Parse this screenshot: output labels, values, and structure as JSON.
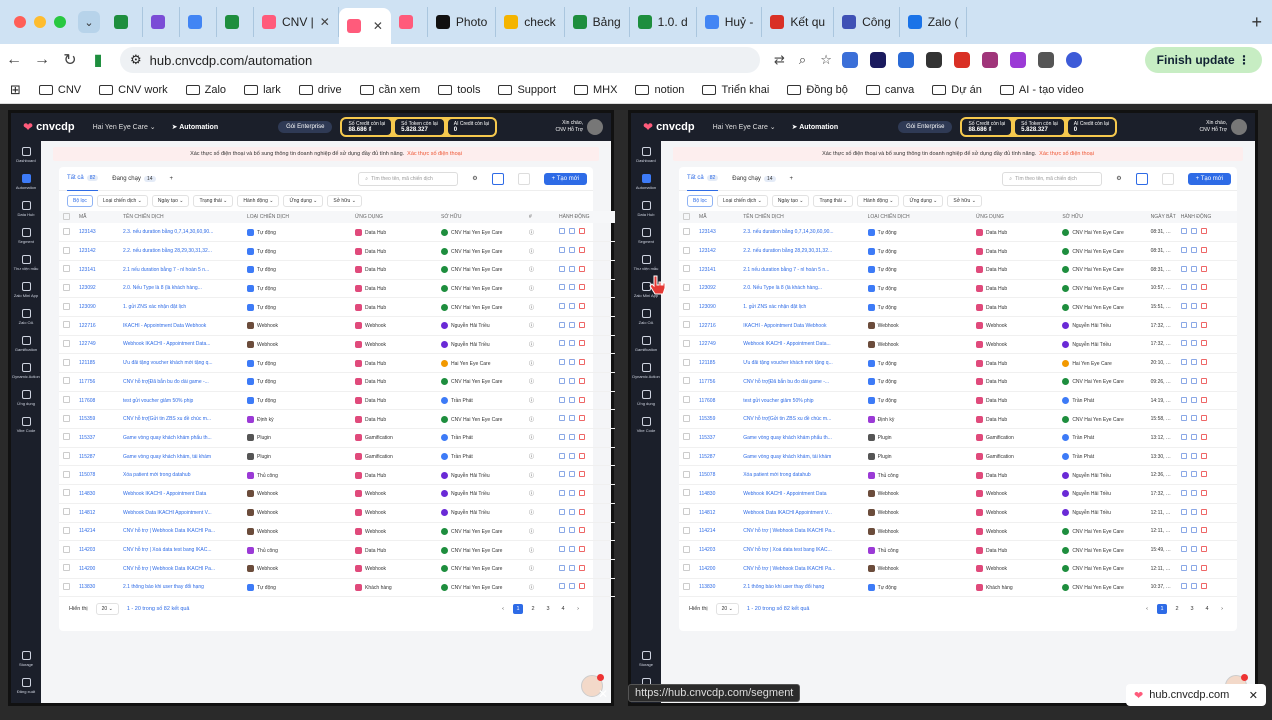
{
  "browser": {
    "tabs": [
      {
        "label": "",
        "color": "#1e8e3e"
      },
      {
        "label": "",
        "color": "#7b4dd6"
      },
      {
        "label": "",
        "color": "#4285f4"
      },
      {
        "label": "",
        "color": "#1e8e3e"
      },
      {
        "label": "CNV |",
        "color": "#ff5b7b"
      },
      {
        "label": "",
        "color": "#ff5b7b",
        "active": true
      },
      {
        "label": "",
        "color": "#ff5b7b"
      },
      {
        "label": "Photo",
        "color": "#111111"
      },
      {
        "label": "check",
        "color": "#f4b400"
      },
      {
        "label": "Bảng",
        "color": "#1e8e3e"
      },
      {
        "label": "1.0. d",
        "color": "#1e8e3e"
      },
      {
        "label": "Huỷ -",
        "color": "#4285f4"
      },
      {
        "label": "Kết qu",
        "color": "#d93025"
      },
      {
        "label": "Công",
        "color": "#3f51b5"
      },
      {
        "label": "Zalo (",
        "color": "#1a73e8"
      }
    ],
    "url": "hub.cnvcdp.com/automation",
    "finish_update": "Finish update",
    "bookmarks": [
      "CNV",
      "CNV work",
      "Zalo",
      "lark",
      "drive",
      "cần xem",
      "tools",
      "Support",
      "MHX",
      "notion",
      "Triển khai",
      "Đồng bộ",
      "canva",
      "Dự án",
      "AI - tạo video"
    ],
    "status_url": "https://hub.cnvcdp.com/segment",
    "popup_label": "hub.cnvcdp.com"
  },
  "app": {
    "logo": "cnvcdp",
    "org": "Hai Yen Eye Care",
    "module": "Automation",
    "plan": "Gói Enterprise",
    "credits": [
      {
        "label": "Số Credit còn lại",
        "value": "88.686 ₫"
      },
      {
        "label": "Số Token còn lại",
        "value": "5.828.327"
      },
      {
        "label": "AI Credit còn lại",
        "value": "0"
      }
    ],
    "hello": "Xin chào,",
    "user": "CNV Hỗ Trợ",
    "sidebar": [
      "Dashboard",
      "Automation",
      "Data Hub",
      "Segment",
      "Thư viện mẫu",
      "Zalo Mini App",
      "Zalo OA",
      "Gamification",
      "Dynamic Action",
      "Ứng dụng",
      "Vibe Code"
    ],
    "sidebar_bottom": [
      "Storage",
      "Đăng xuất"
    ],
    "alert": "Xác thực số điện thoại và bổ sung thông tin doanh nghiệp để sử dụng đầy đủ tính năng.",
    "alert_link": "Xác thực số điện thoại",
    "tab_all": "Tất cả",
    "tab_all_count": "82",
    "tab_running": "Đang chạy",
    "tab_running_count": "14",
    "search_placeholder": "Tìm theo tên, mã chiến dịch",
    "add_button": "+ Tạo mới",
    "filters": [
      "Bộ lọc",
      "Loại chiến dịch",
      "Ngày tạo",
      "Trạng thái",
      "Hành động",
      "Ứng dụng",
      "Sở hữu"
    ],
    "columns_left": [
      "MÃ",
      "TÊN CHIẾN DỊCH",
      "LOẠI CHIẾN DỊCH",
      "ỨNG DỤNG",
      "SỞ HỮU",
      "#",
      "HÀNH ĐỘNG"
    ],
    "columns_right": [
      "MÃ",
      "TÊN CHIẾN DỊCH",
      "LOẠI CHIẾN DỊCH",
      "ỨNG DỤNG",
      "SỞ HỮU",
      "NGÀY BẮT ĐẦU",
      "HÀNH ĐỘNG"
    ],
    "rows": [
      {
        "id": "123143",
        "name": "2.3. nếu duration bằng 0,7,14,30,60,90...",
        "type": "Tự động",
        "app": "Data Hub",
        "owner": "CNV Hai Yen Eye Care",
        "date": "08:31, 13/06/"
      },
      {
        "id": "123142",
        "name": "2.2. nếu duration bằng 28,29,30,31,32...",
        "type": "Tự động",
        "app": "Data Hub",
        "owner": "CNV Hai Yen Eye Care",
        "date": "08:31, 13/06/"
      },
      {
        "id": "123141",
        "name": "2.1 nếu duration bằng 7 - nl hoàn 5 n...",
        "type": "Tự động",
        "app": "Data Hub",
        "owner": "CNV Hai Yen Eye Care",
        "date": "08:31, 13/06/"
      },
      {
        "id": "123092",
        "name": "2.0. Nếu Type là 8 (là khách hàng...",
        "type": "Tự động",
        "app": "Data Hub",
        "owner": "CNV Hai Yen Eye Care",
        "date": "10:57, 12/06/"
      },
      {
        "id": "123090",
        "name": "1. gửi ZNS xác nhận đặt lịch",
        "type": "Tự động",
        "app": "Data Hub",
        "owner": "CNV Hai Yen Eye Care",
        "date": "15:51, 11/06/"
      },
      {
        "id": "122716",
        "name": "IKACHI - Appointment Data Webhook",
        "type": "Webhook",
        "app": "Webhook",
        "owner": "Nguyễn Hải Triều",
        "date": "17:32, 07/06/"
      },
      {
        "id": "122749",
        "name": "Webhook IKACHI - Appointment Data...",
        "type": "Webhook",
        "app": "Webhook",
        "owner": "Nguyễn Hải Triều",
        "date": "17:32, 07/06/"
      },
      {
        "id": "121185",
        "name": "Ưu đãi tặng voucher khách mới tặng q...",
        "type": "Tự động",
        "app": "Data Hub",
        "owner": "Hai Yen Eye Care",
        "date": "20:10, 31/05/"
      },
      {
        "id": "117756",
        "name": "CNV hỗ trợ[Đã bắn bu đo dài game -...",
        "type": "Tự động",
        "app": "Data Hub",
        "owner": "CNV Hai Yen Eye Care",
        "date": "09:26, 04/05/"
      },
      {
        "id": "117608",
        "name": "test gửi voucher giảm 50% phịp",
        "type": "Tự động",
        "app": "Data Hub",
        "owner": "Trần Phát",
        "date": "14:19, 29/04/"
      },
      {
        "id": "115359",
        "name": "CNV hỗ trợ[Gửi tin ZBS xu đề chúc m...",
        "type": "Định kỳ",
        "app": "Data Hub",
        "owner": "CNV Hai Yen Eye Care",
        "date": "15:58, 16/04/"
      },
      {
        "id": "115337",
        "name": "Game vòng quay khách khám phẩu th...",
        "type": "Plugin",
        "app": "Gamification",
        "owner": "Trần Phát",
        "date": "13:12, 10/04/"
      },
      {
        "id": "115287",
        "name": "Game vòng quay khách khám, tái khám",
        "type": "Plugin",
        "app": "Gamification",
        "owner": "Trần Phát",
        "date": "13:30, 10/04/"
      },
      {
        "id": "115078",
        "name": "Xóa patient mới trong datahub",
        "type": "Thủ công",
        "app": "Data Hub",
        "owner": "Nguyễn Hải Triều",
        "date": "12:36, 08/04/"
      },
      {
        "id": "114830",
        "name": "Webhook IKACHI - Appointment Data",
        "type": "Webhook",
        "app": "Webhook",
        "owner": "Nguyễn Hải Triều",
        "date": "17:32, 07/04/"
      },
      {
        "id": "114812",
        "name": "Webhook Data IKACHI Appointment V...",
        "type": "Webhook",
        "app": "Webhook",
        "owner": "Nguyễn Hải Triều",
        "date": "12:11, 28/03/"
      },
      {
        "id": "114214",
        "name": "CNV hỗ trợ | Webhook Data IKACHI Pa...",
        "type": "Webhook",
        "app": "Webhook",
        "owner": "CNV Hai Yen Eye Care",
        "date": "12:11, 26/03/"
      },
      {
        "id": "114203",
        "name": "CNV hỗ trợ | Xoá data test bang IKAC...",
        "type": "Thủ công",
        "app": "Data Hub",
        "owner": "CNV Hai Yen Eye Care",
        "date": "15:49, 03/03/"
      },
      {
        "id": "114200",
        "name": "CNV hỗ trợ | Webhook Data IKACHI Pa...",
        "type": "Webhook",
        "app": "Webhook",
        "owner": "CNV Hai Yen Eye Care",
        "date": "12:11, 26/03/"
      },
      {
        "id": "113830",
        "name": "2.1 thông báo khi user thay đổi hạng",
        "type": "Tự động",
        "app": "Khách hàng",
        "owner": "CNV Hai Yen Eye Care",
        "date": "10:37, 01/04/"
      }
    ],
    "per_page_label": "Hiển thị",
    "per_page": "20",
    "result_text": "1 - 20 trong số 82 kết quả",
    "pages": [
      "1",
      "2",
      "3",
      "4"
    ]
  },
  "colors": {
    "accent": "#2e6be6",
    "dark_nav": "#1b1f2a",
    "brand": "#ff5b7b",
    "webhook": "#6b4c3b",
    "datahub": "#e04a7b",
    "owner": "#1e8e3e"
  }
}
